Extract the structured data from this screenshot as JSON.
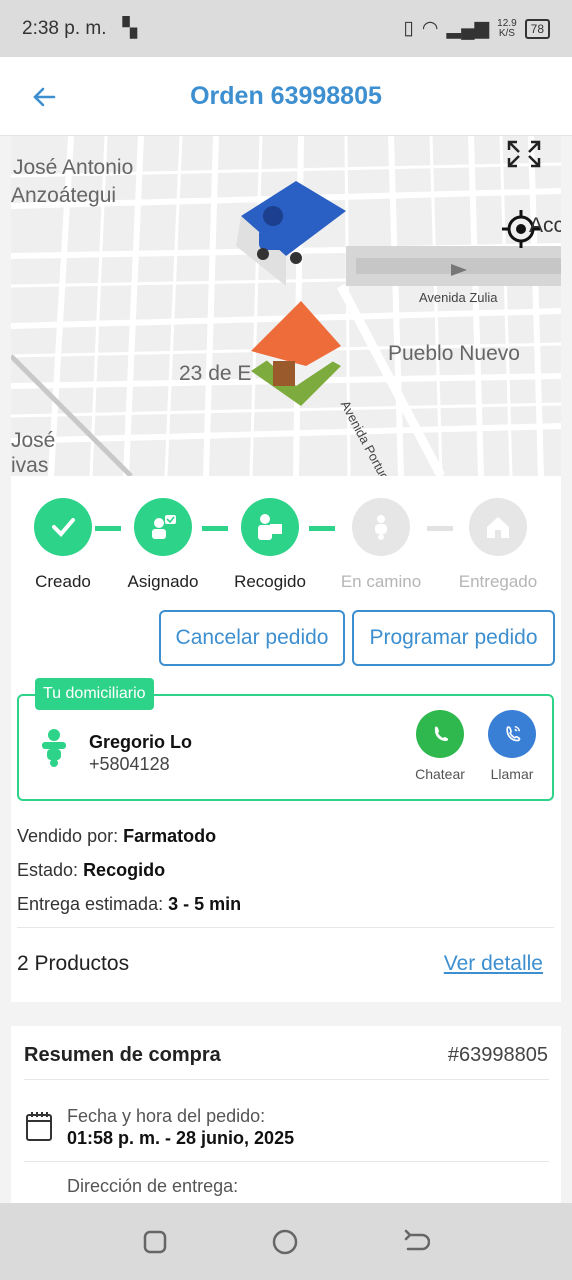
{
  "status_bar": {
    "time": "2:38 p. m.",
    "net_speed": "12.9",
    "net_unit": "K/S",
    "battery": "78"
  },
  "header": {
    "title": "Orden 63998805"
  },
  "map": {
    "labels": [
      "José Antonio",
      "Anzoátegui",
      "Avenida Zulia",
      "Pueblo Nuevo",
      "23 de E",
      "Avenida Portuguesa",
      "José",
      "ivas",
      "Acc"
    ]
  },
  "steps": [
    {
      "label": "Creado",
      "done": true,
      "icon": "check-icon"
    },
    {
      "label": "Asignado",
      "done": true,
      "icon": "assign-icon"
    },
    {
      "label": "Recogido",
      "done": true,
      "icon": "pickup-icon"
    },
    {
      "label": "En camino",
      "done": false,
      "icon": "scooter-icon"
    },
    {
      "label": "Entregado",
      "done": false,
      "icon": "home-icon"
    }
  ],
  "actions": {
    "cancel": "Cancelar pedido",
    "schedule": "Programar pedido"
  },
  "courier": {
    "tag": "Tu domiciliario",
    "name": "Gregorio Lo",
    "phone": "+5804128",
    "chat": "Chatear",
    "call": "Llamar"
  },
  "order_info": {
    "sold_by_label": "Vendido por:",
    "sold_by": "Farmatodo",
    "state_label": "Estado:",
    "state": "Recogido",
    "eta_label": "Entrega estimada:",
    "eta": "3 - 5 min",
    "products": "2 Productos",
    "detail_link": "Ver detalle"
  },
  "summary": {
    "title": "Resumen de compra",
    "order_number": "#63998805",
    "date_label": "Fecha y hora del pedido:",
    "date_value": "01:58 p. m. - 28 junio, 2025",
    "address_label": "Dirección de entrega:"
  },
  "colors": {
    "accent": "#3d8fd0",
    "success": "#2ed38a",
    "whatsapp": "#2fb84d",
    "call": "#3a7fd6"
  }
}
